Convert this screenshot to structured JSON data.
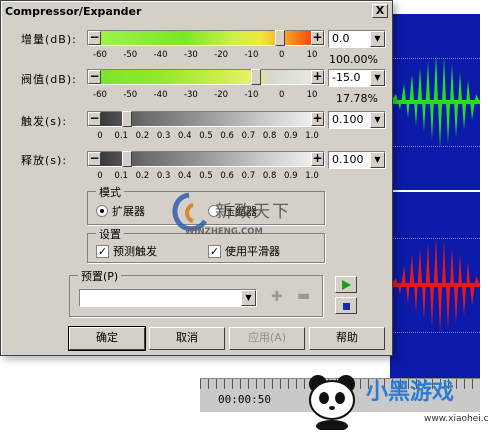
{
  "dialog": {
    "title": "Compressor/Expander",
    "close_glyph": "X"
  },
  "rows": {
    "gain": {
      "label": "增量(dB):",
      "value": "0.0",
      "percent": "100.00%",
      "thumb_fraction": 0.86
    },
    "threshold": {
      "label": "阀值(dB):",
      "value": "-15.0",
      "percent": "17.78%",
      "thumb_fraction": 0.75
    },
    "attack": {
      "label": "触发(s):",
      "value": "0.100",
      "thumb_fraction": 0.1
    },
    "release": {
      "label": "释放(s):",
      "value": "0.100",
      "thumb_fraction": 0.1
    }
  },
  "slider_buttons": {
    "minus": "−",
    "plus": "+"
  },
  "db_ticks": [
    "-60",
    "-50",
    "-40",
    "-30",
    "-20",
    "-10",
    "0",
    "10"
  ],
  "sec_ticks": [
    "0",
    "0.1",
    "0.2",
    "0.3",
    "0.4",
    "0.5",
    "0.6",
    "0.7",
    "0.8",
    "0.9",
    "1.0"
  ],
  "mode": {
    "label": "模式",
    "expander": "扩展器",
    "compressor": "压缩器",
    "selected": "expander"
  },
  "settings": {
    "label": "设置",
    "predict_trigger": "预测触发",
    "use_smoother": "使用平滑器"
  },
  "preset": {
    "label": "预置(P)",
    "value": ""
  },
  "buttons": {
    "ok": "确定",
    "cancel": "取消",
    "apply": "应用(A)",
    "help": "帮助"
  },
  "timeline": {
    "time": "00:00:50"
  },
  "watermark": {
    "text": "新政天下",
    "url": "WINZHENG.COM"
  },
  "brand": {
    "title": "小黑游戏",
    "url": "www.xiaohei.com"
  },
  "colors": {
    "wave_blue": "#0b1aa8",
    "wave_green": "#20e020",
    "wave_red": "#e81818",
    "dialog_bg": "#d4d0c8"
  }
}
